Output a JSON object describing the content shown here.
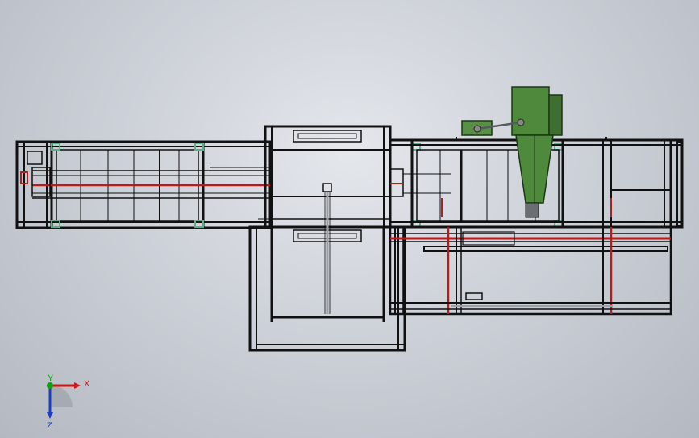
{
  "viewport": {
    "background_center": "#e4e7ec",
    "background_edge": "#b4b9c1"
  },
  "model": {
    "frame_color": "#111111",
    "rail_red": "#b01e1e",
    "gearbox_green": "#4f8a3c",
    "bracket_green": "#5fae8a",
    "shaft_gray": "#9aa0a6"
  },
  "triad": {
    "x_label": "X",
    "y_label": "Y",
    "z_label": "Z",
    "x_color": "#d21414",
    "y_color": "#10a010",
    "z_color": "#1a3cc8",
    "icon": "coordinate-triad-icon"
  }
}
